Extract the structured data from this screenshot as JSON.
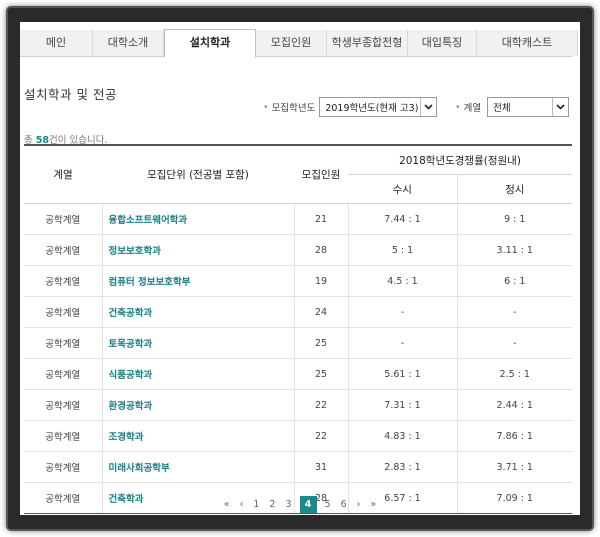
{
  "nav": {
    "tabs": [
      "메인",
      "대학소개",
      "설치학과",
      "모집인원",
      "학생부종합전형",
      "대입특징",
      "대학캐스트"
    ],
    "active_index": 2
  },
  "page_title": "설치학과 및 전공",
  "filters": {
    "year_label": "모집학년도",
    "year_value": "2019학년도(현재 고3)",
    "field_label": "계열",
    "field_value": "전체"
  },
  "count": {
    "prefix": "총 ",
    "value": "58",
    "suffix": "건이 있습니다."
  },
  "table": {
    "headers": {
      "field": "계열",
      "unit": "모집단위 (전공별 포함)",
      "quota": "모집인원",
      "competition": "2018학년도경쟁률(정원내)",
      "early": "수시",
      "regular": "정시"
    },
    "rows": [
      [
        "공학계열",
        "융합소프트웨어학과",
        "21",
        "7.44 : 1",
        "9 : 1"
      ],
      [
        "공학계열",
        "정보보호학과",
        "28",
        "5 : 1",
        "3.11 : 1"
      ],
      [
        "공학계열",
        "컴퓨터 정보보호학부",
        "19",
        "4.5 : 1",
        "6 : 1"
      ],
      [
        "공학계열",
        "건축공학과",
        "24",
        "-",
        "-"
      ],
      [
        "공학계열",
        "토목공학과",
        "25",
        "-",
        "-"
      ],
      [
        "공학계열",
        "식품공학과",
        "25",
        "5.61 : 1",
        "2.5 : 1"
      ],
      [
        "공학계열",
        "환경공학과",
        "22",
        "7.31 : 1",
        "2.44 : 1"
      ],
      [
        "공학계열",
        "조경학과",
        "22",
        "4.83 : 1",
        "7.86 : 1"
      ],
      [
        "공학계열",
        "미래사회공학부",
        "31",
        "2.83 : 1",
        "3.71 : 1"
      ],
      [
        "공학계열",
        "건축학과",
        "28",
        "6.57 : 1",
        "7.09 : 1"
      ]
    ]
  },
  "pagination": {
    "first": "«",
    "prev": "‹",
    "pages": [
      "1",
      "2",
      "3",
      "4",
      "5",
      "6"
    ],
    "current": "4",
    "next": "›",
    "last": "»"
  },
  "colors": {
    "accent": "#1a8b8b",
    "link": "#1b7f86"
  }
}
